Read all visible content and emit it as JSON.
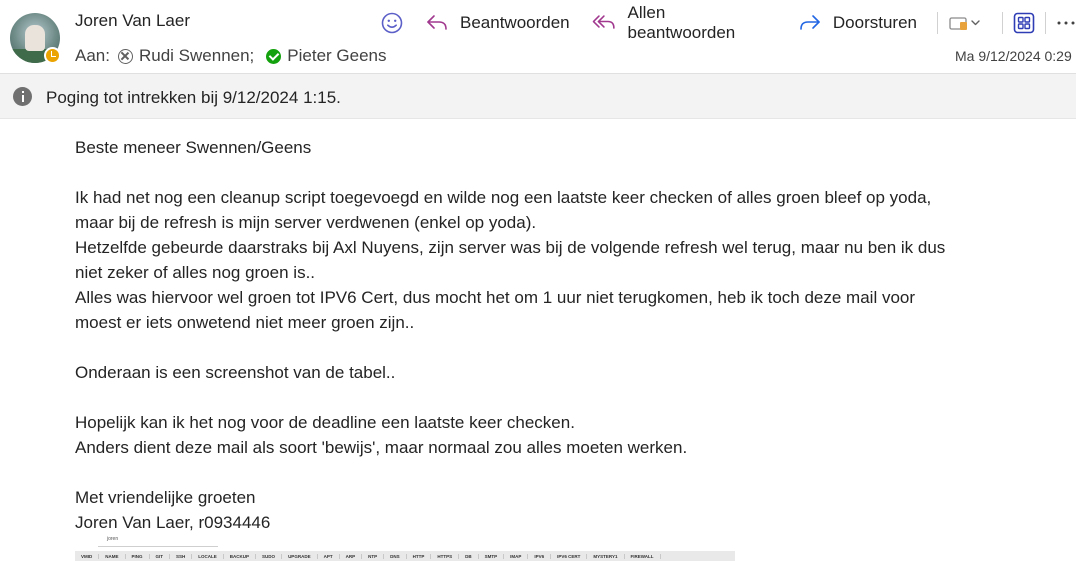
{
  "header": {
    "sender": "Joren Van Laer",
    "to_label": "Aan:",
    "recipients": [
      {
        "name": "Rudi Swennen;",
        "status_icon": "blocked-icon"
      },
      {
        "name": "Pieter Geens",
        "status_icon": "available-check-icon"
      }
    ],
    "date": "Ma 9/12/2024 0:29",
    "presence_color": "#EAA300"
  },
  "toolbar": {
    "reply_label": "Beantwoorden",
    "reply_all_label": "Allen beantwoorden",
    "forward_label": "Doorsturen",
    "accent_color": "#5B5FC7"
  },
  "infobar": {
    "text": "Poging tot intrekken bij 9/12/2024 1:15."
  },
  "message": {
    "lines": [
      "Beste meneer Swennen/Geens",
      "",
      "Ik had net nog een cleanup script toegevoegd en wilde nog een laatste keer checken of alles groen bleef op yoda,",
      "maar bij de refresh is mijn server verdwenen (enkel op yoda).",
      "Hetzelfde gebeurde daarstraks bij Axl Nuyens, zijn server was bij de volgende refresh wel terug, maar nu ben ik dus",
      "niet zeker of alles nog groen is..",
      "Alles was hiervoor wel groen tot IPV6 Cert, dus mocht het om 1 uur niet terugkomen, heb ik toch deze mail voor",
      "moest er iets onwetend niet meer groen zijn..",
      "",
      "Onderaan is een screenshot van de tabel..",
      "",
      "Hopelijk kan ik het nog voor de deadline een laatste keer checken.",
      "Anders dient deze mail als soort 'bewijs', maar normaal zou alles moeten werken.",
      "",
      "Met vriendelijke groeten",
      "Joren Van Laer, r0934446"
    ]
  },
  "screenshot_preview": {
    "label": "joren",
    "columns": [
      "VMID",
      "NAME",
      "PING",
      "GIT",
      "SSH",
      "LOCALE",
      "BACKUP",
      "SUDO",
      "UPGRADE",
      "APT",
      "ARP",
      "NTP",
      "DNS",
      "HTTP",
      "HTTPS",
      "DB",
      "SMTP",
      "IMAP",
      "IPV6",
      "IPV6 CERT",
      "MYSTERY1",
      "FIREWALL"
    ]
  }
}
